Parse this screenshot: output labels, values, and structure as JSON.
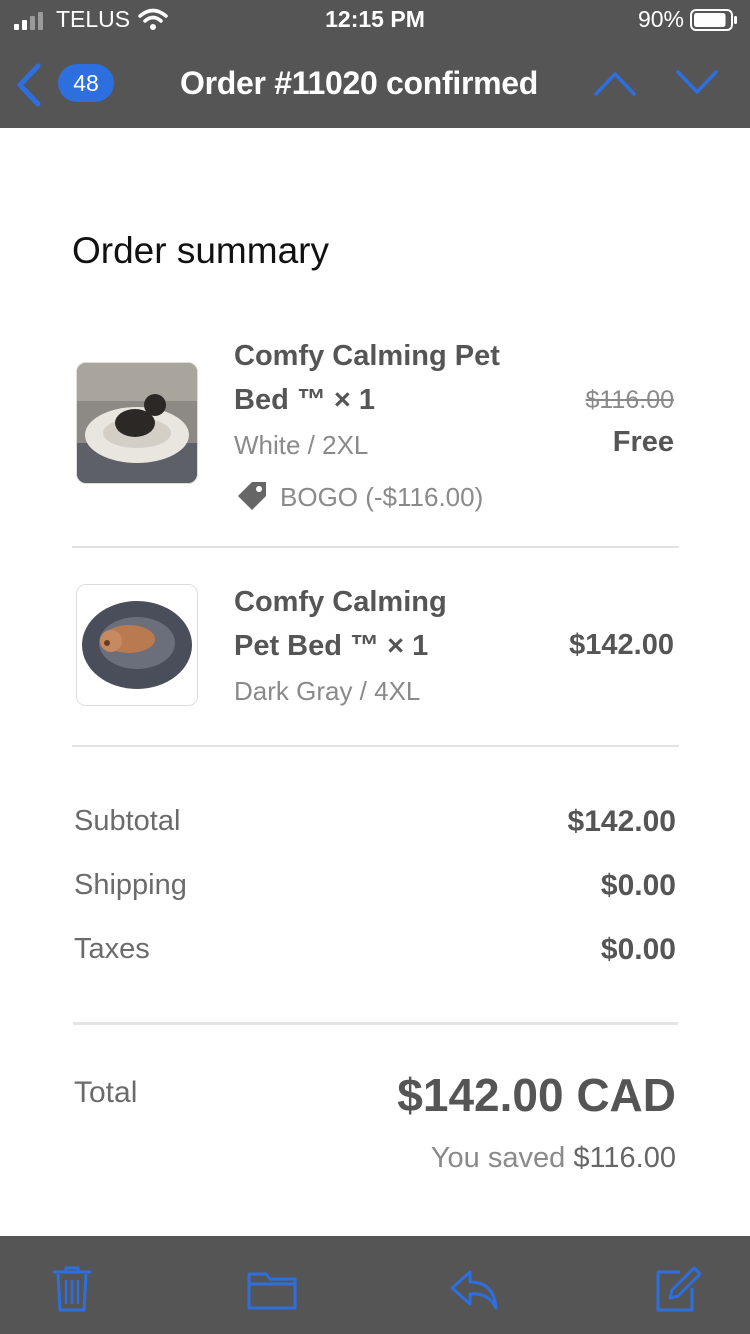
{
  "status_bar": {
    "carrier": "TELUS",
    "time": "12:15 PM",
    "battery": "90%",
    "battery_level": 0.9
  },
  "nav": {
    "unread_count": "48",
    "title": "Order #11020 confirmed",
    "accent_color": "#2e6fe0"
  },
  "summary": {
    "heading": "Order summary",
    "items": [
      {
        "name_line1": "Comfy Calming Pet",
        "name_line2": "Bed ™ × 1",
        "variant": "White / 2XL",
        "discount": "BOGO (-$116.00)",
        "original_price": "$116.00",
        "price": "Free"
      },
      {
        "name_line1": "Comfy Calming",
        "name_line2": "Pet Bed ™ × 1",
        "variant": "Dark Gray / 4XL",
        "price": "$142.00"
      }
    ],
    "subtotal_label": "Subtotal",
    "subtotal": "$142.00",
    "shipping_label": "Shipping",
    "shipping": "$0.00",
    "taxes_label": "Taxes",
    "taxes": "$0.00",
    "total_label": "Total",
    "total": "$142.00 CAD",
    "saved_prefix": "You saved",
    "saved_amount": "$116.00"
  },
  "toolbar": {
    "icons": [
      "trash-icon",
      "folder-icon",
      "reply-icon",
      "compose-icon"
    ]
  }
}
